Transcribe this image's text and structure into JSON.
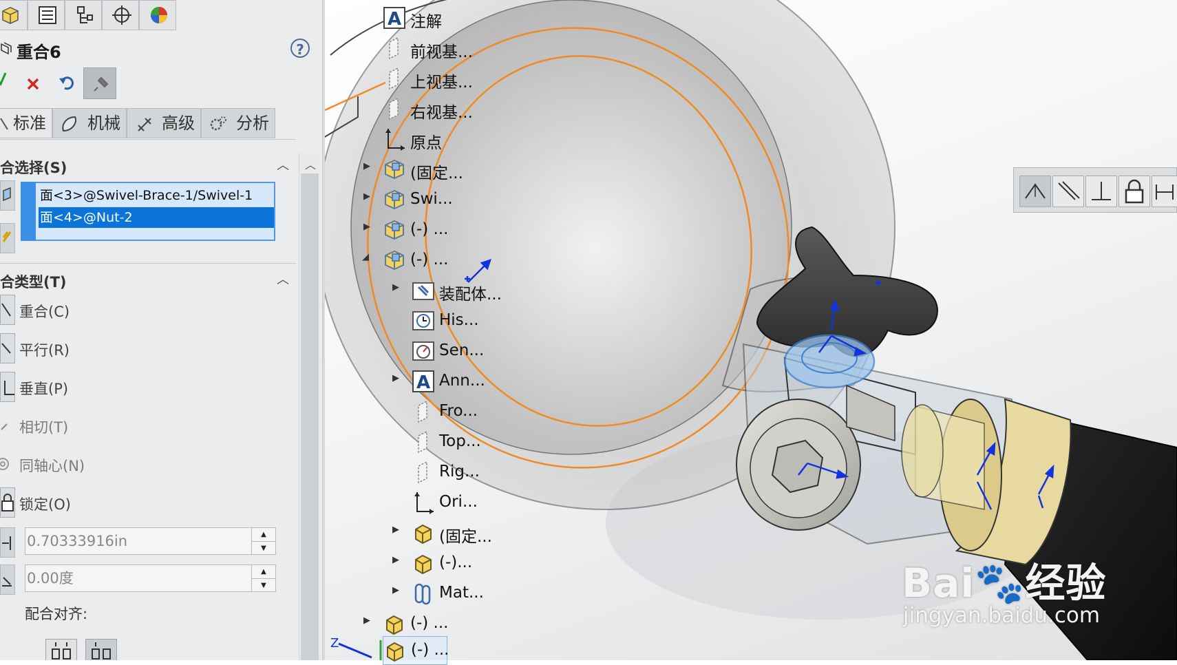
{
  "panel": {
    "title": "重合6",
    "help_label": "?",
    "tabs": [
      {
        "label": "标准"
      },
      {
        "label": "机械"
      },
      {
        "label": "高级"
      },
      {
        "label": "分析"
      }
    ],
    "selection_section": "合选择(S)",
    "selections": [
      {
        "label": "面<3>@Swivel-Brace-1/Swivel-1",
        "selected": false
      },
      {
        "label": "面<4>@Nut-2",
        "selected": true
      }
    ],
    "type_section": "合类型(T)",
    "mate_types": [
      {
        "label": "重合(C)",
        "active": true,
        "enabled": true
      },
      {
        "label": "平行(R)",
        "active": false,
        "enabled": true
      },
      {
        "label": "垂直(P)",
        "active": false,
        "enabled": true
      },
      {
        "label": "相切(T)",
        "active": false,
        "enabled": false
      },
      {
        "label": "同轴心(N)",
        "active": false,
        "enabled": false
      },
      {
        "label": "锁定(O)",
        "active": false,
        "enabled": true
      }
    ],
    "distance_value": "0.70333916in",
    "angle_value": "0.00度",
    "alignment_label": "配合对齐:"
  },
  "tree": {
    "items": [
      {
        "label": "注解",
        "icon": "annotation-icon"
      },
      {
        "label": "前视基...",
        "icon": "plane-icon"
      },
      {
        "label": "上视基...",
        "icon": "plane-icon"
      },
      {
        "label": "右视基...",
        "icon": "plane-icon"
      },
      {
        "label": "原点",
        "icon": "origin-icon"
      },
      {
        "label": "(固定...",
        "icon": "assembly-icon"
      },
      {
        "label": "Swi...",
        "icon": "assembly-icon"
      },
      {
        "label": "(-) ...",
        "icon": "assembly-icon"
      },
      {
        "label": "(-) ...",
        "icon": "assembly-icon"
      },
      {
        "label": "装配体...",
        "icon": "assembly-feature-icon"
      },
      {
        "label": "His...",
        "icon": "history-icon"
      },
      {
        "label": "Sen...",
        "icon": "sensor-icon"
      },
      {
        "label": "Ann...",
        "icon": "annotation-icon"
      },
      {
        "label": "Fro...",
        "icon": "plane-icon"
      },
      {
        "label": "Top...",
        "icon": "plane-icon"
      },
      {
        "label": "Rig...",
        "icon": "plane-icon"
      },
      {
        "label": "Ori...",
        "icon": "origin-icon"
      },
      {
        "label": "(固定...",
        "icon": "part-icon"
      },
      {
        "label": "(-)...",
        "icon": "part-icon"
      },
      {
        "label": "Mat...",
        "icon": "mates-icon"
      },
      {
        "label": "(-) ...",
        "icon": "part-icon"
      },
      {
        "label": "(-) ...",
        "icon": "part-icon"
      }
    ]
  },
  "watermark": {
    "brand": "Bai🐾经验",
    "url": "jingyan.baidu.com"
  },
  "colors": {
    "selection_blue": "#0a74da",
    "highlight_orange": "#f08a24",
    "mate_blue": "#1133dd",
    "brass": "#e8d9a0"
  }
}
